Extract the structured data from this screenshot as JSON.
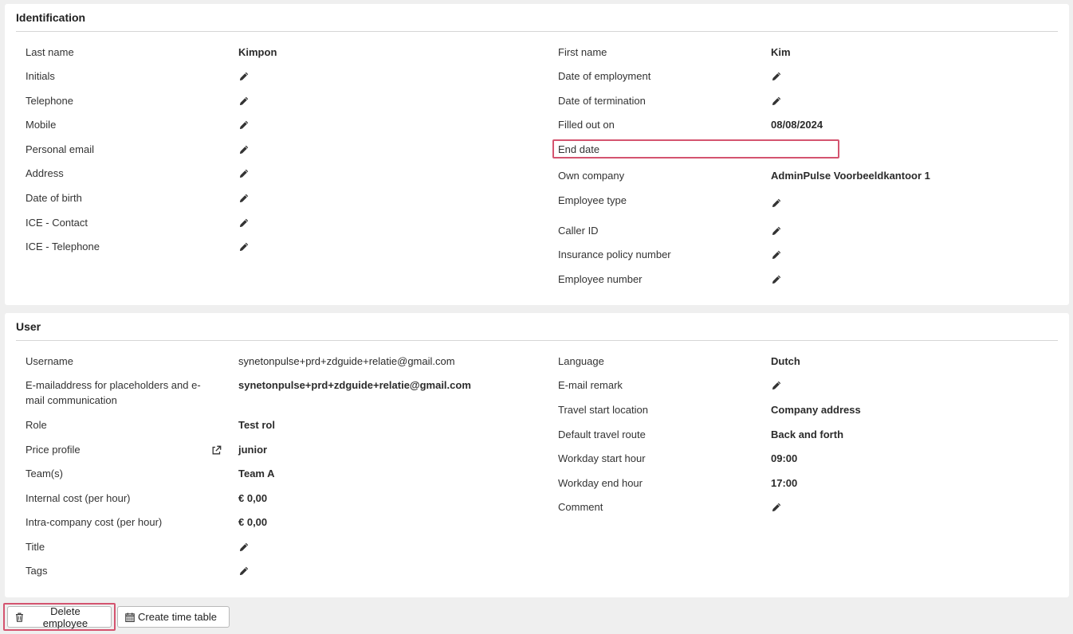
{
  "identification": {
    "title": "Identification",
    "left": [
      {
        "label": "Last name",
        "value": "Kimpon"
      },
      {
        "label": "Initials",
        "value": null
      },
      {
        "label": "Telephone",
        "value": null
      },
      {
        "label": "Mobile",
        "value": null
      },
      {
        "label": "Personal email",
        "value": null
      },
      {
        "label": "Address",
        "value": null
      },
      {
        "label": "Date of birth",
        "value": null
      },
      {
        "label": "ICE - Contact",
        "value": null
      },
      {
        "label": "ICE - Telephone",
        "value": null
      }
    ],
    "right": [
      {
        "label": "First name",
        "value": "Kim"
      },
      {
        "label": "Date of employment",
        "value": null
      },
      {
        "label": "Date of termination",
        "value": null
      },
      {
        "label": "Filled out on",
        "value": "08/08/2024"
      },
      {
        "label": "End date",
        "value": ""
      },
      {
        "label": "Own company",
        "value": "AdminPulse Voorbeeldkantoor 1"
      },
      {
        "label": "Employee type",
        "value": null
      },
      {
        "label": "Caller ID",
        "value": null
      },
      {
        "label": "Insurance policy number",
        "value": null
      },
      {
        "label": "Employee number",
        "value": null
      }
    ]
  },
  "user": {
    "title": "User",
    "left": [
      {
        "label": "Username",
        "value": "synetonpulse+prd+zdguide+relatie@gmail.com"
      },
      {
        "label": "E-mailaddress for placeholders and e-mail communication",
        "value": "synetonpulse+prd+zdguide+relatie@gmail.com"
      },
      {
        "label": "Role",
        "value": "Test rol"
      },
      {
        "label": "Price profile",
        "value": "junior"
      },
      {
        "label": "Team(s)",
        "value": "Team A"
      },
      {
        "label": "Internal cost (per hour)",
        "value": "€ 0,00"
      },
      {
        "label": "Intra-company cost (per hour)",
        "value": "€ 0,00"
      },
      {
        "label": "Title",
        "value": null
      },
      {
        "label": "Tags",
        "value": null
      }
    ],
    "right": [
      {
        "label": "Language",
        "value": "Dutch"
      },
      {
        "label": "E-mail remark",
        "value": null
      },
      {
        "label": "Travel start location",
        "value": "Company address"
      },
      {
        "label": "Default travel route",
        "value": "Back and forth"
      },
      {
        "label": "Workday start hour",
        "value": "09:00"
      },
      {
        "label": "Workday end hour",
        "value": "17:00"
      },
      {
        "label": "Comment",
        "value": null
      }
    ]
  },
  "actions": {
    "delete_label": "Delete employee",
    "timetable_label": "Create time table"
  },
  "icons": {
    "edit": "pencil-icon",
    "external": "external-link-icon",
    "delete": "trash-icon",
    "calendar": "calendar-icon"
  },
  "colors": {
    "highlight": "#d4546f",
    "background": "#efefef"
  }
}
